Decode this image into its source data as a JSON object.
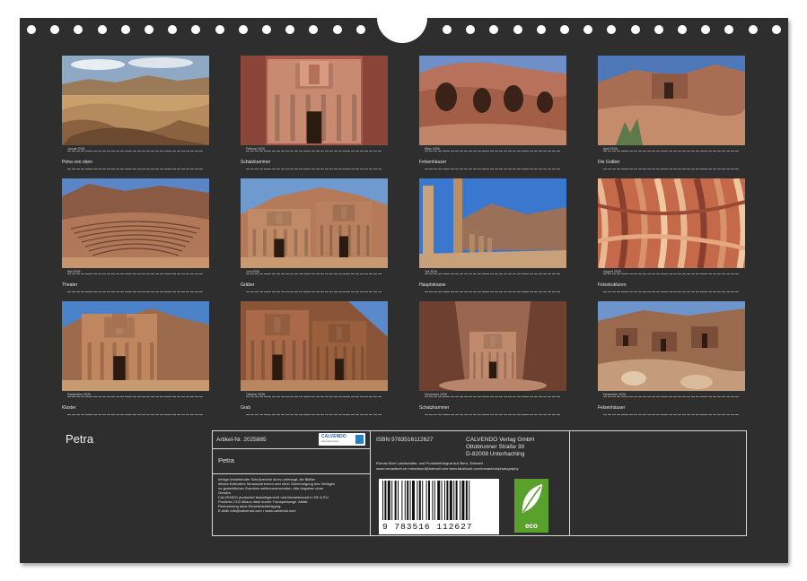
{
  "calendar_title": "Petra",
  "months": [
    {
      "month": "Januar 2026",
      "caption": "Petra von oben",
      "scene": "vista"
    },
    {
      "month": "Februar 2026",
      "caption": "Schatzkammer",
      "scene": "treasury"
    },
    {
      "month": "März 2026",
      "caption": "Felsenhäuser",
      "scene": "caves"
    },
    {
      "month": "April 2026",
      "caption": "Die Gräber",
      "scene": "tombs-blue"
    },
    {
      "month": "Mai 2026",
      "caption": "Theater",
      "scene": "theater"
    },
    {
      "month": "Juni 2026",
      "caption": "Gräber",
      "scene": "royal-tombs"
    },
    {
      "month": "Juli 2026",
      "caption": "Hauptstrasse",
      "scene": "columns"
    },
    {
      "month": "August 2026",
      "caption": "Felsstrukturen",
      "scene": "rock-texture"
    },
    {
      "month": "September 2026",
      "caption": "Kloster",
      "scene": "monastery"
    },
    {
      "month": "Oktober 2026",
      "caption": "Grab",
      "scene": "tomb-facade"
    },
    {
      "month": "November 2026",
      "caption": "Schatzkammer",
      "scene": "treasury-distance"
    },
    {
      "month": "Dezember 2026",
      "caption": "Felsenhäuser",
      "scene": "cliff-houses"
    }
  ],
  "info_box": {
    "article": "Artikel-Nr. 2025885",
    "product_title": "Petra",
    "publisher_logo": "CALVENDO",
    "publisher_logo_sub": "www.calvendo.de",
    "legal_text": [
      "Infolge bestehender Schutzrechte ist es untersagt, die Blätter",
      "dieses Kalenders herauszutrennen und ohne Genehmigung des Verlages",
      "zu gewerblichen Zwecken weiterzuverwenden. Alle Angaben ohne",
      "Gewähr.",
      "CALVENDO produziert bedarfsgerecht und klimabewusst in DE & EU.",
      "Positives CO2-Bilanz dank kurzer Transportwege, Abfall-",
      "Reduzierung dank Einzelstückfertigung.",
      "E-Mail: info@calvendo.com • www.calvendo.com"
    ],
    "isbn": "ISBN 9783516112627",
    "publisher_name": "CALVENDO Verlag GmbH",
    "publisher_street": "Ottobrunner Straße 39",
    "publisher_city": "D-82008 Unterhaching",
    "author_line1": "Roman Burri Landschafts- und Produktefotograf aus Bern, Schweiz",
    "author_line2": "www.romanburri.ch romanburri@hotmail.com www.facebook.com/romanburriphotography",
    "barcode_number": "9 783516 112627",
    "eco_label": "eco"
  },
  "colors": {
    "page_background": "#2e2e2e",
    "text": "#e8e8e8",
    "eco_green": "#5aa02c"
  }
}
